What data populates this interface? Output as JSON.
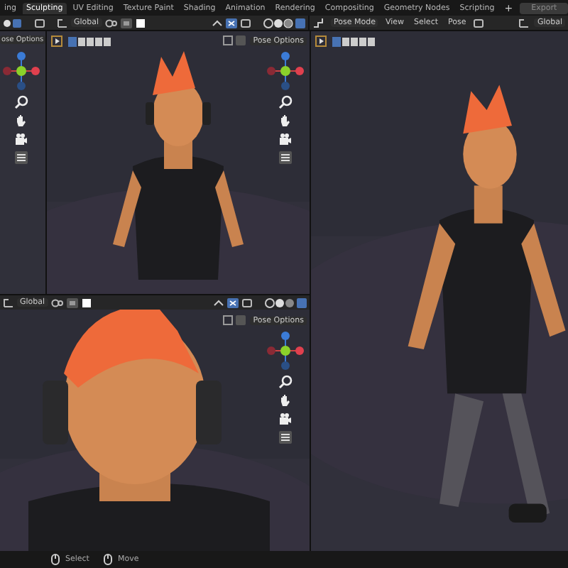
{
  "workspace_tabs": [
    {
      "label": "ing",
      "selected": false
    },
    {
      "label": "Sculpting",
      "selected": true
    },
    {
      "label": "UV Editing",
      "selected": false
    },
    {
      "label": "Texture Paint",
      "selected": false
    },
    {
      "label": "Shading",
      "selected": false
    },
    {
      "label": "Animation",
      "selected": false
    },
    {
      "label": "Rendering",
      "selected": false
    },
    {
      "label": "Compositing",
      "selected": false
    },
    {
      "label": "Geometry Nodes",
      "selected": false
    },
    {
      "label": "Scripting",
      "selected": false
    }
  ],
  "add_tab": "+",
  "export_button": "Export",
  "header": {
    "orientation": "Global",
    "mode": "Pose Mode",
    "menus": [
      "View",
      "Select",
      "Pose"
    ],
    "orientation_right": "Global"
  },
  "viewports": [
    {
      "kind": "none",
      "pose_options": "ose Options"
    },
    {
      "kind": "standing",
      "pose_options": "Pose Options"
    },
    {
      "kind": "closeup",
      "orientation": "Global",
      "pose_options": "Pose Options"
    },
    {
      "kind": "running"
    }
  ],
  "status_bar": [
    {
      "label": "Select"
    },
    {
      "label": "Move"
    }
  ]
}
